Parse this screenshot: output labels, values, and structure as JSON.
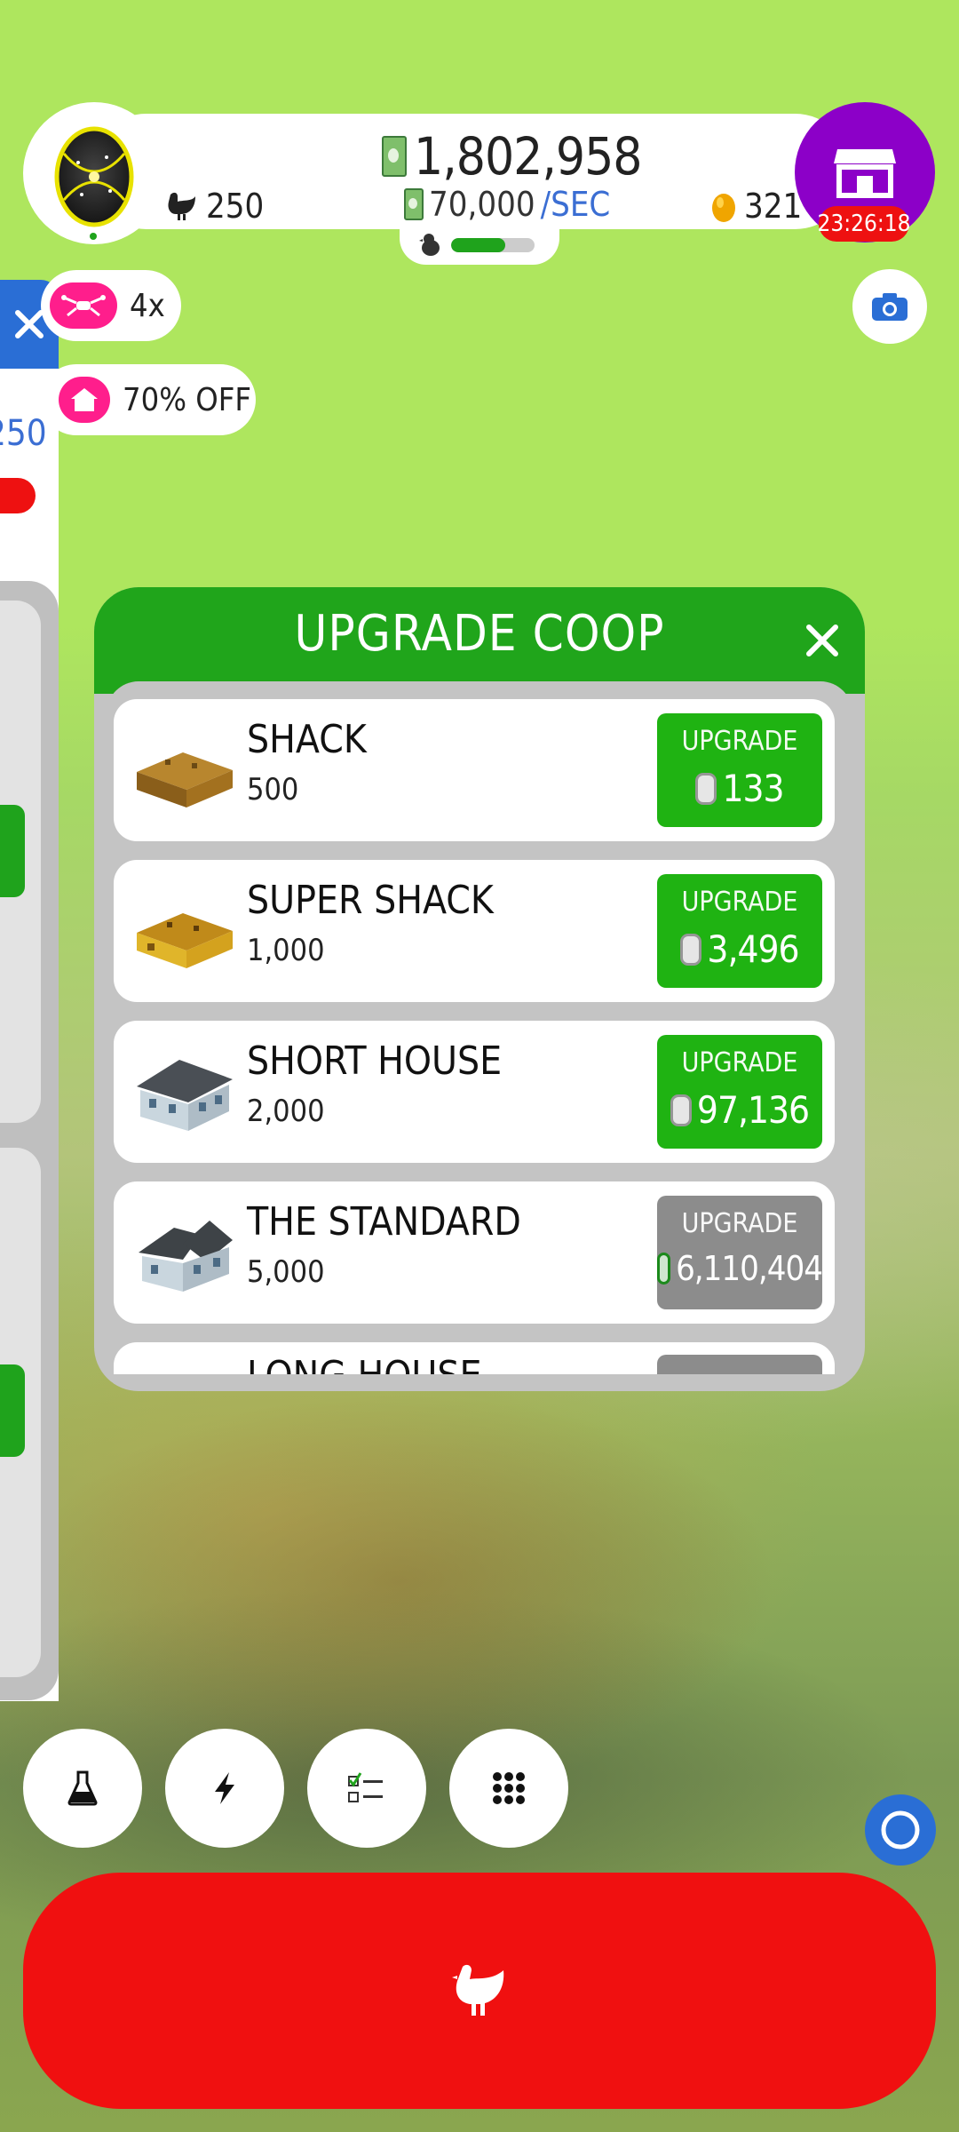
{
  "hud": {
    "money": "1,802,958",
    "rate": "70,000",
    "rate_unit": "/SEC",
    "chickens": "250",
    "golden_eggs": "321",
    "shop_timer": "23:26:18",
    "progress_percent": 65
  },
  "side": {
    "value": "250"
  },
  "boosts": {
    "drone_label": "4x",
    "discount_label": "70% OFF"
  },
  "modal": {
    "title": "UPGRADE COOP",
    "rows": [
      {
        "name": "SHACK",
        "capacity": "500",
        "button_label": "UPGRADE",
        "cost": "133",
        "affordable": true
      },
      {
        "name": "SUPER SHACK",
        "capacity": "1,000",
        "button_label": "UPGRADE",
        "cost": "3,496",
        "affordable": true
      },
      {
        "name": "SHORT HOUSE",
        "capacity": "2,000",
        "button_label": "UPGRADE",
        "cost": "97,136",
        "affordable": true
      },
      {
        "name": "THE STANDARD",
        "capacity": "5,000",
        "button_label": "UPGRADE",
        "cost": "6,110,404",
        "affordable": false
      },
      {
        "name": "LONG HOUSE",
        "capacity": "",
        "button_label": "",
        "cost": "",
        "affordable": false
      }
    ]
  },
  "colors": {
    "green": "#20a51b",
    "red": "#f01010",
    "purple": "#8c00c8",
    "blue": "#2a6ed5",
    "pink": "#ff1e8c",
    "gray_button": "#8c8c8c"
  },
  "icons": {
    "research": "flask-icon",
    "boosts": "lightning-icon",
    "missions": "checklist-icon",
    "menu": "grid-icon",
    "hatch": "chicken-icon"
  }
}
